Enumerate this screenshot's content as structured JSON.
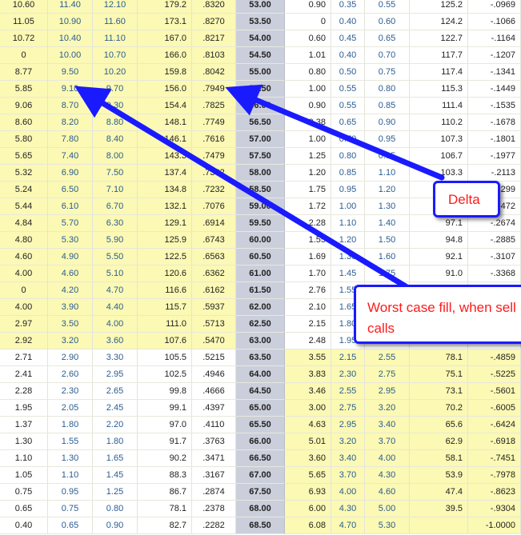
{
  "table": {
    "rows": [
      {
        "c": [
          "10.60",
          "11.40",
          "12.10",
          "179.2",
          ".8320",
          "53.00",
          "0.90",
          "0.35",
          "0.55",
          "125.2",
          "-.0969"
        ],
        "call_itm": true
      },
      {
        "c": [
          "11.05",
          "10.90",
          "11.60",
          "173.1",
          ".8270",
          "53.50",
          "0",
          "0.40",
          "0.60",
          "124.2",
          "-.1066"
        ],
        "call_itm": true
      },
      {
        "c": [
          "10.72",
          "10.40",
          "11.10",
          "167.0",
          ".8217",
          "54.00",
          "0.60",
          "0.45",
          "0.65",
          "122.7",
          "-.1164"
        ],
        "call_itm": true
      },
      {
        "c": [
          "0",
          "10.00",
          "10.70",
          "166.0",
          ".8103",
          "54.50",
          "1.01",
          "0.40",
          "0.70",
          "117.7",
          "-.1207"
        ],
        "call_itm": true
      },
      {
        "c": [
          "8.77",
          "9.50",
          "10.20",
          "159.8",
          ".8042",
          "55.00",
          "0.80",
          "0.50",
          "0.75",
          "117.4",
          "-.1341"
        ],
        "call_itm": true
      },
      {
        "c": [
          "5.85",
          "9.10",
          "9.70",
          "156.0",
          ".7949",
          "55.50",
          "1.00",
          "0.55",
          "0.80",
          "115.3",
          "-.1449"
        ],
        "call_itm": true
      },
      {
        "c": [
          "9.06",
          "8.70",
          "9.30",
          "154.4",
          ".7825",
          "56.00",
          "0.90",
          "0.55",
          "0.85",
          "111.4",
          "-.1535"
        ],
        "call_itm": true
      },
      {
        "c": [
          "8.60",
          "8.20",
          "8.80",
          "148.1",
          ".7749",
          "56.50",
          "0.38",
          "0.65",
          "0.90",
          "110.2",
          "-.1678"
        ],
        "call_itm": true
      },
      {
        "c": [
          "5.80",
          "7.80",
          "8.40",
          "146.1",
          ".7616",
          "57.00",
          "1.00",
          "0.70",
          "0.95",
          "107.3",
          "-.1801"
        ],
        "call_itm": true
      },
      {
        "c": [
          "5.65",
          "7.40",
          "8.00",
          "143.3",
          ".7479",
          "57.50",
          "1.25",
          "0.80",
          "0.95",
          "106.7",
          "-.1977"
        ],
        "call_itm": true
      },
      {
        "c": [
          "5.32",
          "6.90",
          "7.50",
          "137.4",
          ".7382",
          "58.00",
          "1.20",
          "0.85",
          "1.10",
          "103.3",
          "-.2113"
        ],
        "call_itm": true
      },
      {
        "c": [
          "5.24",
          "6.50",
          "7.10",
          "134.8",
          ".7232",
          "58.50",
          "1.75",
          "0.95",
          "1.20",
          "",
          "-.2299"
        ],
        "call_itm": true
      },
      {
        "c": [
          "5.44",
          "6.10",
          "6.70",
          "132.1",
          ".7076",
          "59.00",
          "1.72",
          "1.00",
          "1.30",
          "",
          "-.2472"
        ],
        "call_itm": true
      },
      {
        "c": [
          "4.84",
          "5.70",
          "6.30",
          "129.1",
          ".6914",
          "59.50",
          "2.28",
          "1.10",
          "1.40",
          "97.1",
          "-.2674"
        ],
        "call_itm": true
      },
      {
        "c": [
          "4.80",
          "5.30",
          "5.90",
          "125.9",
          ".6743",
          "60.00",
          "1.55",
          "1.20",
          "1.50",
          "94.8",
          "-.2885"
        ],
        "call_itm": true
      },
      {
        "c": [
          "4.60",
          "4.90",
          "5.50",
          "122.5",
          ".6563",
          "60.50",
          "1.69",
          "1.30",
          "1.60",
          "92.1",
          "-.3107"
        ],
        "call_itm": true
      },
      {
        "c": [
          "4.00",
          "4.60",
          "5.10",
          "120.6",
          ".6362",
          "61.00",
          "1.70",
          "1.45",
          "1.75",
          "91.0",
          "-.3368"
        ],
        "call_itm": true
      },
      {
        "c": [
          "0",
          "4.20",
          "4.70",
          "116.6",
          ".6162",
          "61.50",
          "2.76",
          "1.55",
          "",
          "",
          ""
        ],
        "call_itm": true
      },
      {
        "c": [
          "4.00",
          "3.90",
          "4.40",
          "115.7",
          ".5937",
          "62.00",
          "2.10",
          "1.65",
          "",
          "",
          ""
        ],
        "call_itm": true
      },
      {
        "c": [
          "2.97",
          "3.50",
          "4.00",
          "111.0",
          ".5713",
          "62.50",
          "2.15",
          "1.80",
          "",
          "",
          ""
        ],
        "call_itm": true
      },
      {
        "c": [
          "2.92",
          "3.20",
          "3.60",
          "107.6",
          ".5470",
          "63.00",
          "2.48",
          "1.95",
          "",
          "",
          ""
        ],
        "call_itm": true
      },
      {
        "c": [
          "2.71",
          "2.90",
          "3.30",
          "105.5",
          ".5215",
          "63.50",
          "3.55",
          "2.15",
          "2.55",
          "78.1",
          "-.4859"
        ],
        "call_itm": false
      },
      {
        "c": [
          "2.41",
          "2.60",
          "2.95",
          "102.5",
          ".4946",
          "64.00",
          "3.83",
          "2.30",
          "2.75",
          "75.1",
          "-.5225"
        ],
        "call_itm": false
      },
      {
        "c": [
          "2.28",
          "2.30",
          "2.65",
          "99.8",
          ".4666",
          "64.50",
          "3.46",
          "2.55",
          "2.95",
          "73.1",
          "-.5601"
        ],
        "call_itm": false
      },
      {
        "c": [
          "1.95",
          "2.05",
          "2.45",
          "99.1",
          ".4397",
          "65.00",
          "3.00",
          "2.75",
          "3.20",
          "70.2",
          "-.6005"
        ],
        "call_itm": false
      },
      {
        "c": [
          "1.37",
          "1.80",
          "2.20",
          "97.0",
          ".4110",
          "65.50",
          "4.63",
          "2.95",
          "3.40",
          "65.6",
          "-.6424"
        ],
        "call_itm": false
      },
      {
        "c": [
          "1.30",
          "1.55",
          "1.80",
          "91.7",
          ".3763",
          "66.00",
          "5.01",
          "3.20",
          "3.70",
          "62.9",
          "-.6918"
        ],
        "call_itm": false
      },
      {
        "c": [
          "1.10",
          "1.30",
          "1.65",
          "90.2",
          ".3471",
          "66.50",
          "3.60",
          "3.40",
          "4.00",
          "58.1",
          "-.7451"
        ],
        "call_itm": false
      },
      {
        "c": [
          "1.05",
          "1.10",
          "1.45",
          "88.3",
          ".3167",
          "67.00",
          "5.65",
          "3.70",
          "4.30",
          "53.9",
          "-.7978"
        ],
        "call_itm": false
      },
      {
        "c": [
          "0.75",
          "0.95",
          "1.25",
          "86.7",
          ".2874",
          "67.50",
          "6.93",
          "4.00",
          "4.60",
          "47.4",
          "-.8623"
        ],
        "call_itm": false
      },
      {
        "c": [
          "0.65",
          "0.75",
          "0.80",
          "78.1",
          ".2378",
          "68.00",
          "6.00",
          "4.30",
          "5.00",
          "39.5",
          "-.9304"
        ],
        "call_itm": false
      },
      {
        "c": [
          "0.40",
          "0.65",
          "0.90",
          "82.7",
          ".2282",
          "68.50",
          "6.08",
          "4.70",
          "5.30",
          "",
          "-1.0000"
        ],
        "call_itm": false
      }
    ]
  },
  "annotations": {
    "delta_label": "Delta",
    "worst_case_line1": "Worst case fill, when sell",
    "worst_case_line2": "calls",
    "arrow_color": "#1a1aff",
    "text_color": "#ff1a1a"
  },
  "colors": {
    "in_the_money": "#fbf9b4",
    "strike_column": "#cbcfdb",
    "number_blue": "#2b5c91"
  }
}
